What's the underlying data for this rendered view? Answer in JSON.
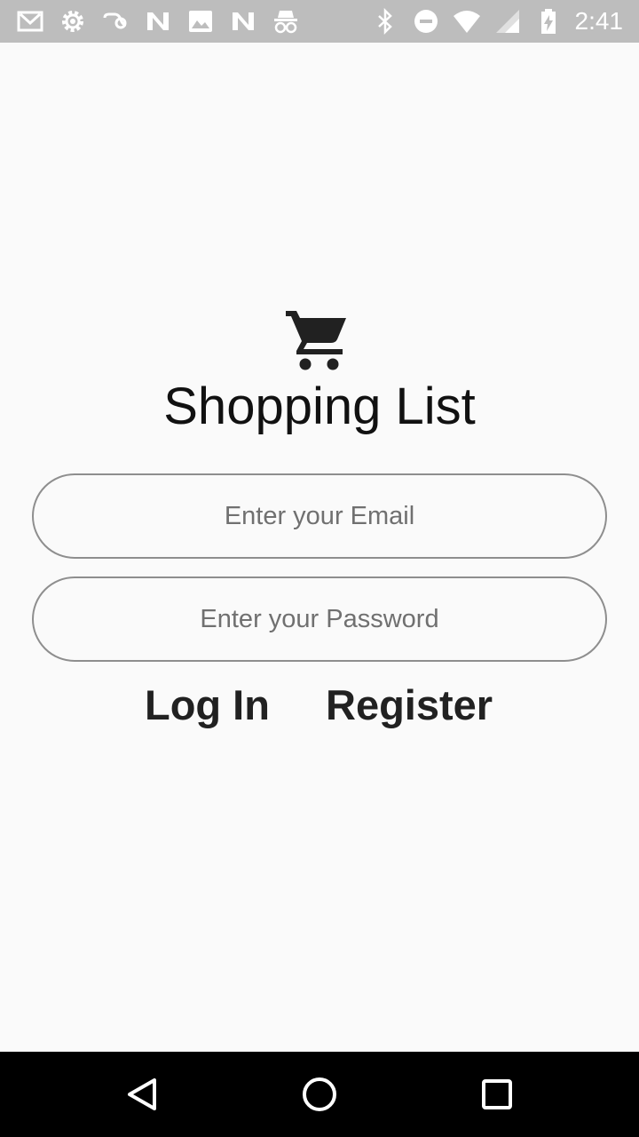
{
  "status_bar": {
    "time": "2:41",
    "left_icons": [
      "gmail-icon",
      "settings-gear-icon",
      "link-icon",
      "n-app-icon",
      "image-icon",
      "n-app-icon",
      "incognito-icon"
    ],
    "right_icons": [
      "bluetooth-icon",
      "do-not-disturb-icon",
      "wifi-icon",
      "cell-signal-icon",
      "battery-charging-icon"
    ]
  },
  "app": {
    "logo_icon": "shopping-cart-icon",
    "title": "Shopping List"
  },
  "login_form": {
    "email_value": "",
    "email_placeholder": "Enter your Email",
    "password_value": "",
    "password_placeholder": "Enter your Password",
    "login_label": "Log In",
    "register_label": "Register"
  },
  "nav_bar": {
    "icons": [
      "back-icon",
      "home-icon",
      "recents-icon"
    ]
  },
  "colors": {
    "status_bar_bg": "#bdbdbd",
    "background": "#fafafa",
    "field_border": "#8e8e8e",
    "text_dark": "#212121",
    "nav_bar_bg": "#000000"
  }
}
